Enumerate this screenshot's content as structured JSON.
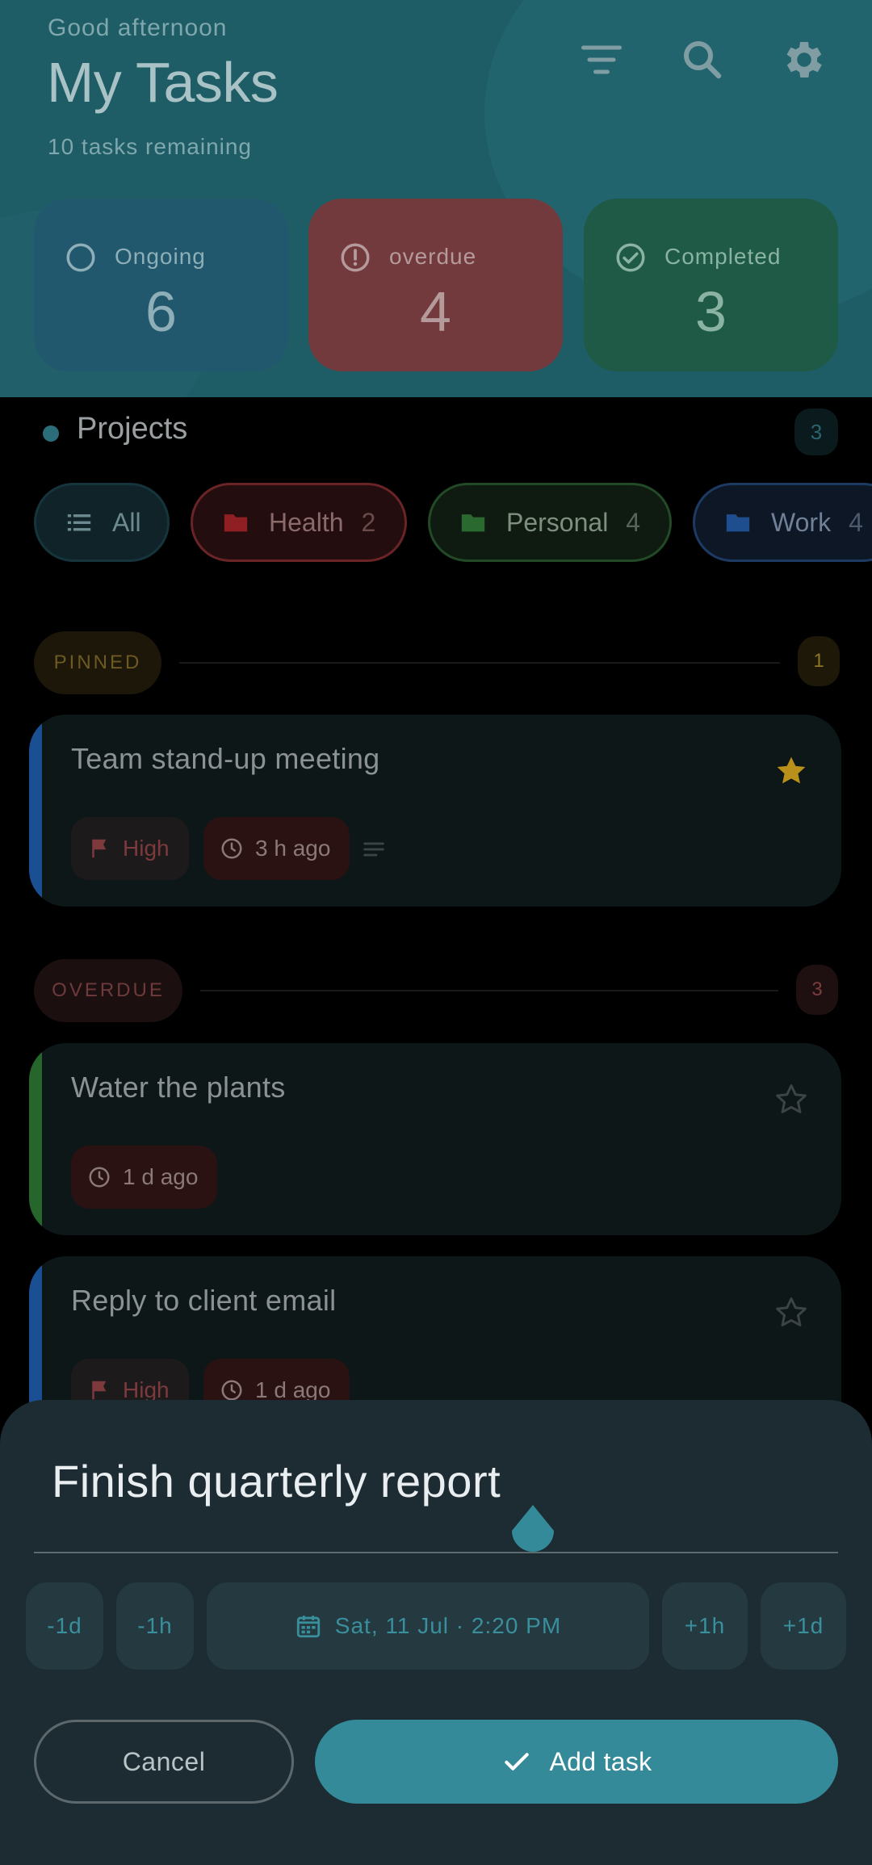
{
  "header": {
    "greeting": "Good afternoon",
    "title": "My Tasks",
    "remaining": "10 tasks remaining",
    "icons": [
      "sort-icon",
      "search-icon",
      "settings-icon"
    ]
  },
  "stats": {
    "ongoing": {
      "label": "Ongoing",
      "value": "6"
    },
    "overdue": {
      "label": "overdue",
      "value": "4"
    },
    "completed": {
      "label": "Completed",
      "value": "3"
    }
  },
  "projects": {
    "title": "Projects",
    "count": "3",
    "chips": [
      {
        "label": "All",
        "count": ""
      },
      {
        "label": "Health",
        "count": "2"
      },
      {
        "label": "Personal",
        "count": "4"
      },
      {
        "label": "Work",
        "count": "4"
      }
    ]
  },
  "sections": {
    "pinned": {
      "label": "PINNED",
      "count": "1"
    },
    "overdue": {
      "label": "OVERDUE",
      "count": "3"
    }
  },
  "tasks": [
    {
      "title": "Team stand-up meeting",
      "priority": "High",
      "time": "3 h ago",
      "starred": true
    },
    {
      "title": "Water the plants",
      "time": "1 d ago",
      "starred": false
    },
    {
      "title": "Reply to client email",
      "priority": "High",
      "time": "1 d ago",
      "starred": false
    }
  ],
  "sheet": {
    "task_input": "Finish quarterly report",
    "adjust": {
      "minus_day": "-1d",
      "minus_hour": "-1h",
      "date": "Sat, 11 Jul · 2:20 PM",
      "plus_hour": "+1h",
      "plus_day": "+1d"
    },
    "cancel_label": "Cancel",
    "add_label": "Add task"
  },
  "colors": {
    "accent": "#358a99",
    "header_bg": "#1f5d66",
    "overdue": "#733a3d",
    "completed": "#1e5a45"
  }
}
